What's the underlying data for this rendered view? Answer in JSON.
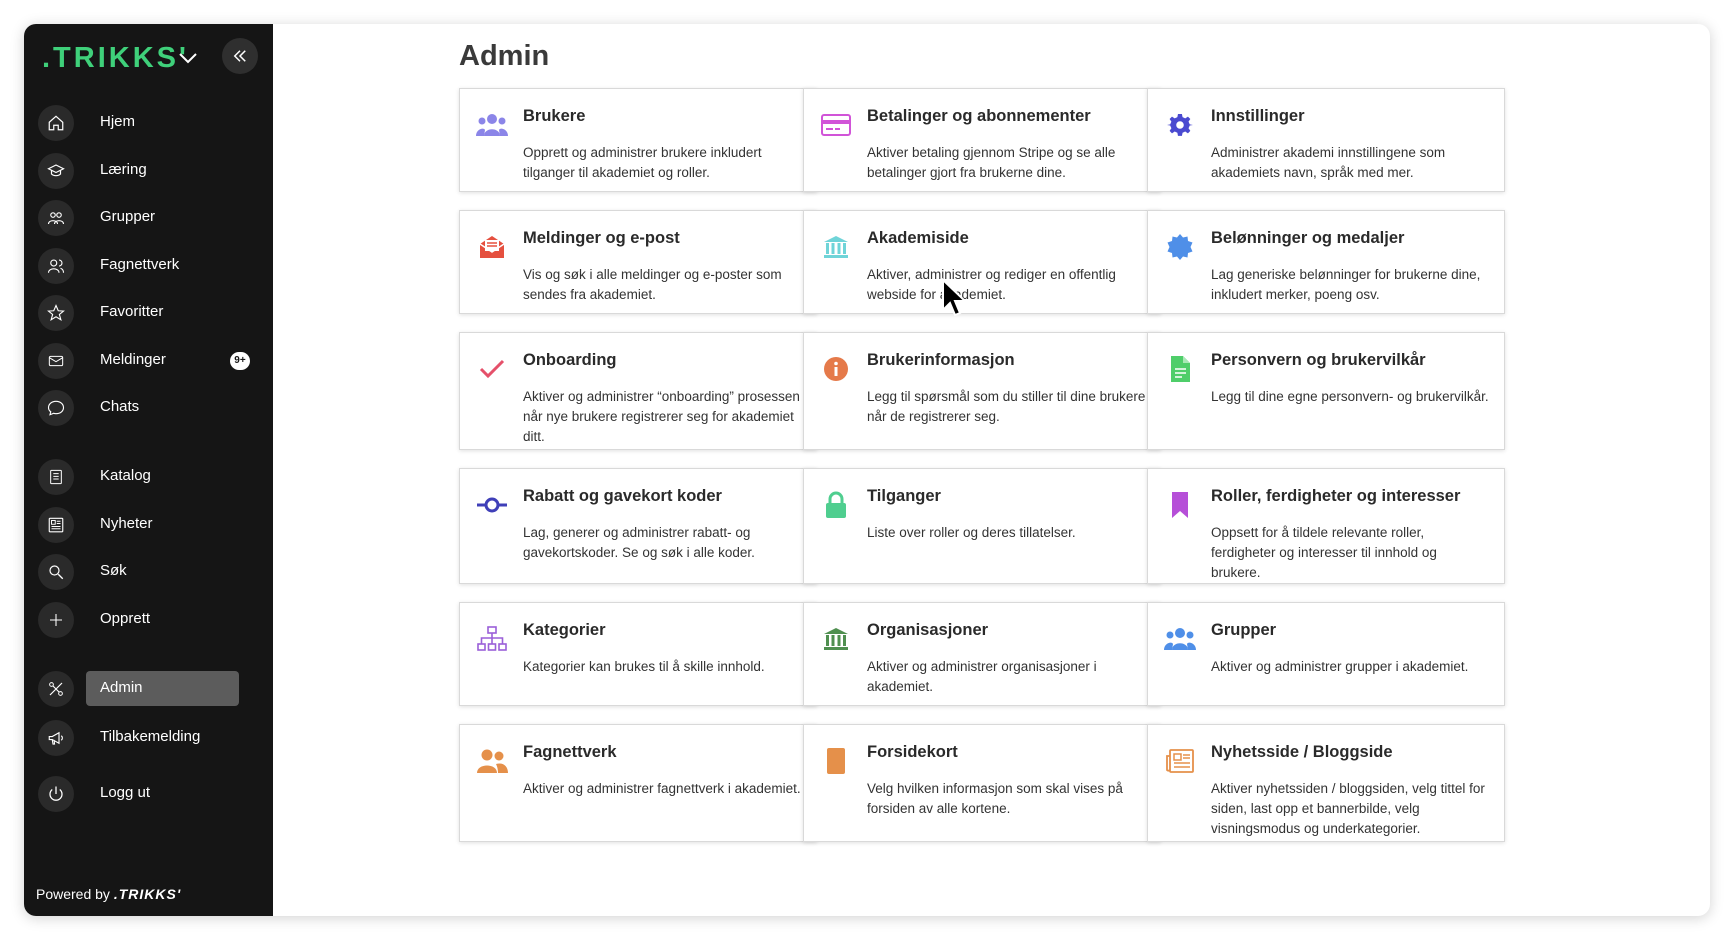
{
  "sidebar": {
    "logo": ".TRIKKS'",
    "nav": [
      {
        "label": "Hjem",
        "icon": "home-icon"
      },
      {
        "label": "Læring",
        "icon": "graduation-cap-icon"
      },
      {
        "label": "Grupper",
        "icon": "group-icon"
      },
      {
        "label": "Fagnettverk",
        "icon": "network-icon"
      },
      {
        "label": "Favoritter",
        "icon": "star-icon"
      },
      {
        "label": "Meldinger",
        "icon": "envelope-icon",
        "badge": "9+"
      },
      {
        "label": "Chats",
        "icon": "chat-bubble-icon"
      },
      {
        "label": "Katalog",
        "icon": "catalog-icon"
      },
      {
        "label": "Nyheter",
        "icon": "newspaper-icon"
      },
      {
        "label": "Søk",
        "icon": "search-icon"
      },
      {
        "label": "Opprett",
        "icon": "plus-icon"
      },
      {
        "label": "Admin",
        "icon": "tools-icon",
        "active": true
      },
      {
        "label": "Tilbakemelding",
        "icon": "megaphone-icon"
      },
      {
        "label": "Logg ut",
        "icon": "power-icon"
      }
    ],
    "powered_prefix": "Powered by",
    "powered_brand": ".TRIKKS'"
  },
  "main": {
    "title": "Admin",
    "cards": [
      {
        "title": "Brukere",
        "desc": "Opprett og administrer brukere inkludert tilganger til akademiet og roller.",
        "icon": "users-icon",
        "color": "#8b85e8"
      },
      {
        "title": "Betalinger og abonnementer",
        "desc": "Aktiver betaling gjennom Stripe og se alle betalinger gjort fra brukerne dine.",
        "icon": "credit-card-icon",
        "color": "#d154d8"
      },
      {
        "title": "Innstillinger",
        "desc": "Administrer akademi innstillingene som akademiets navn, språk med mer.",
        "icon": "gear-icon",
        "color": "#4a4ad0"
      },
      {
        "title": "Meldinger og e-post",
        "desc": "Vis og søk i alle meldinger og e-poster som sendes fra akademiet.",
        "icon": "mail-open-icon",
        "color": "#e5503f"
      },
      {
        "title": "Akademiside",
        "desc": "Aktiver, administrer og rediger en offentlig webside for akademiet.",
        "icon": "institution-icon",
        "color": "#6fd4d8"
      },
      {
        "title": "Belønninger og medaljer",
        "desc": "Lag generiske belønninger for brukerne dine, inkludert merker, poeng osv.",
        "icon": "badge-icon",
        "color": "#4f8fe8"
      },
      {
        "title": "Onboarding",
        "desc": "Aktiver og administrer “onboarding” prosessen når nye brukere registrerer seg for akademiet ditt.",
        "icon": "checkmark-icon",
        "color": "#e5506a"
      },
      {
        "title": "Brukerinformasjon",
        "desc": "Legg til spørsmål som du stiller til dine brukere når de registrerer seg.",
        "icon": "info-icon",
        "color": "#e57a4a"
      },
      {
        "title": "Personvern og brukervilkår",
        "desc": "Legg til dine egne personvern- og brukervilkår.",
        "icon": "document-icon",
        "color": "#4fce6a"
      },
      {
        "title": "Rabatt og gavekort koder",
        "desc": "Lag, generer og administrer rabatt- og gavekortskoder. Se og søk i alle koder.",
        "icon": "commit-icon",
        "color": "#3f3fb8"
      },
      {
        "title": "Tilganger",
        "desc": "Liste over roller og deres tillatelser.",
        "icon": "lock-icon",
        "color": "#4fce8f"
      },
      {
        "title": "Roller, ferdigheter og interesser",
        "desc": "Oppsett for å tildele relevante roller, ferdigheter og interesser til innhold og brukere.",
        "icon": "bookmark-icon",
        "color": "#b64fd8"
      },
      {
        "title": "Kategorier",
        "desc": "Kategorier kan brukes til å skille innhold.",
        "icon": "sitemap-icon",
        "color": "#9a5fd8"
      },
      {
        "title": "Organisasjoner",
        "desc": "Aktiver og administrer organisasjoner i akademiet.",
        "icon": "bank-icon",
        "color": "#4f8f4f"
      },
      {
        "title": "Grupper",
        "desc": "Aktiver og administrer grupper i akademiet.",
        "icon": "users-icon",
        "color": "#4f8fe8"
      },
      {
        "title": "Fagnettverk",
        "desc": "Aktiver og administrer fagnettverk i akademiet.",
        "icon": "people-icon",
        "color": "#e5904a"
      },
      {
        "title": "Forsidekort",
        "desc": "Velg hvilken informasjon som skal vises på forsiden av alle kortene.",
        "icon": "card-icon",
        "color": "#e5904a"
      },
      {
        "title": "Nyhetsside / Bloggside",
        "desc": "Aktiver nyhetssiden / bloggsiden, velg tittel for siden, last opp et bannerbilde, velg visningsmodus og underkategorier.",
        "icon": "newspaper-icon",
        "color": "#e5904a"
      }
    ]
  }
}
